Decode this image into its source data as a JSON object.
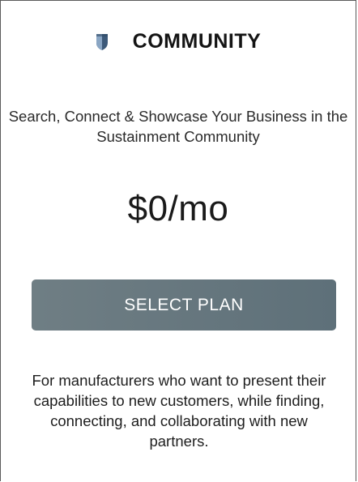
{
  "plan": {
    "title": "COMMUNITY",
    "icon": "shield-icon",
    "tagline": "Search, Connect & Showcase Your Business in the Sustainment Community",
    "price": "$0/mo",
    "button_label": "SELECT PLAN",
    "description": "For manufacturers who want to present their capabilities to new customers, while finding, connecting, and collaborating with new partners."
  },
  "colors": {
    "button_start": "#6f7e84",
    "button_end": "#5e7079",
    "icon_light": "#8aa6c4",
    "icon_dark": "#3d5a7a"
  }
}
